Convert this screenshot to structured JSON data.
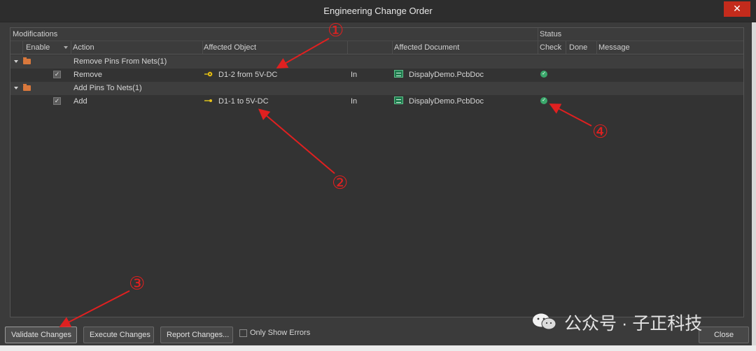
{
  "window": {
    "title": "Engineering Change Order",
    "close_glyph": "✕"
  },
  "grid": {
    "group_headers": {
      "modifications": "Modifications",
      "status": "Status"
    },
    "columns": {
      "enable": "Enable",
      "action": "Action",
      "affected_object": "Affected Object",
      "affected_document": "Affected Document",
      "check": "Check",
      "done": "Done",
      "message": "Message"
    },
    "rows": [
      {
        "type": "group",
        "label": "Remove Pins From Nets(1)",
        "icon": "folder-icon"
      },
      {
        "type": "item",
        "enabled": true,
        "action": "Remove",
        "object_icon": "pin-remove-icon",
        "object": "D1-2 from 5V-DC",
        "direction": "In",
        "document_icon": "pcb-doc-icon",
        "document": "DispalyDemo.PcbDoc",
        "check_icon": "check-ok-icon"
      },
      {
        "type": "group",
        "label": "Add Pins To Nets(1)",
        "icon": "folder-icon"
      },
      {
        "type": "item",
        "enabled": true,
        "action": "Add",
        "object_icon": "pin-add-icon",
        "object": "D1-1 to 5V-DC",
        "direction": "In",
        "document_icon": "pcb-doc-icon",
        "document": "DispalyDemo.PcbDoc",
        "check_icon": "check-ok-icon"
      }
    ]
  },
  "buttons": {
    "validate": "Validate Changes",
    "execute": "Execute Changes",
    "report": "Report Changes...",
    "close": "Close"
  },
  "options": {
    "only_show_errors": "Only Show Errors",
    "only_show_errors_checked": false
  },
  "annotations": {
    "n1": "①",
    "n2": "②",
    "n3": "③",
    "n4": "④"
  },
  "watermark": {
    "text": "公众号 · 子正科技"
  },
  "colors": {
    "arrow": "#e02020",
    "ok": "#3aa86b",
    "close_btn": "#c42b1c"
  }
}
